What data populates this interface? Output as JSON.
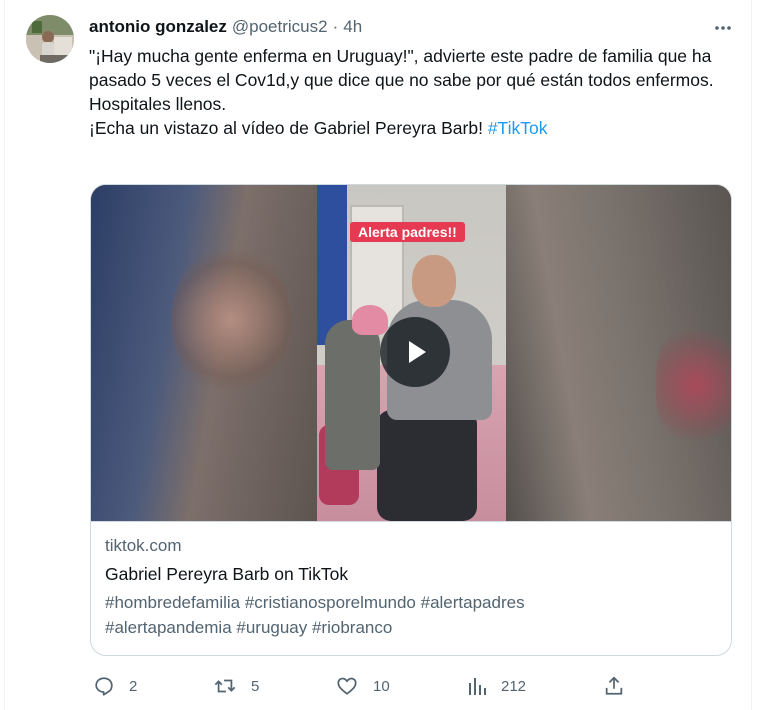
{
  "tweet": {
    "display_name": "antonio gonzalez",
    "handle": "@poetricus2",
    "separator": "·",
    "time": "4h",
    "more_icon": "more-dots-icon",
    "text_paragraphs": [
      "\"¡Hay mucha gente enferma en Uruguay!\", advierte este padre de familia que ha pasado 5 veces el Cov1d,y que dice que no sabe por qué están todos enfermos.",
      "Hospitales llenos."
    ],
    "last_line_text": "¡Echa un vistazo al vídeo de Gabriel Pereyra Barb! ",
    "last_line_hashtag": "#TikTok"
  },
  "card": {
    "video_overlay_label": "Alerta padres!!",
    "play_icon": "play-icon",
    "domain": "tiktok.com",
    "title": "Gabriel Pereyra Barb on TikTok",
    "description_line1": "#hombredefamilia #cristianosporelmundo #alertapadres",
    "description_line2": "#alertapandemia #uruguay #riobranco"
  },
  "actions": {
    "reply_count": "2",
    "retweet_count": "5",
    "like_count": "10",
    "views_count": "212"
  },
  "colors": {
    "text_primary": "#0f1419",
    "text_secondary": "#536471",
    "accent": "#1d9bf0",
    "border": "#cfd9de",
    "label_red": "#e63a52"
  }
}
